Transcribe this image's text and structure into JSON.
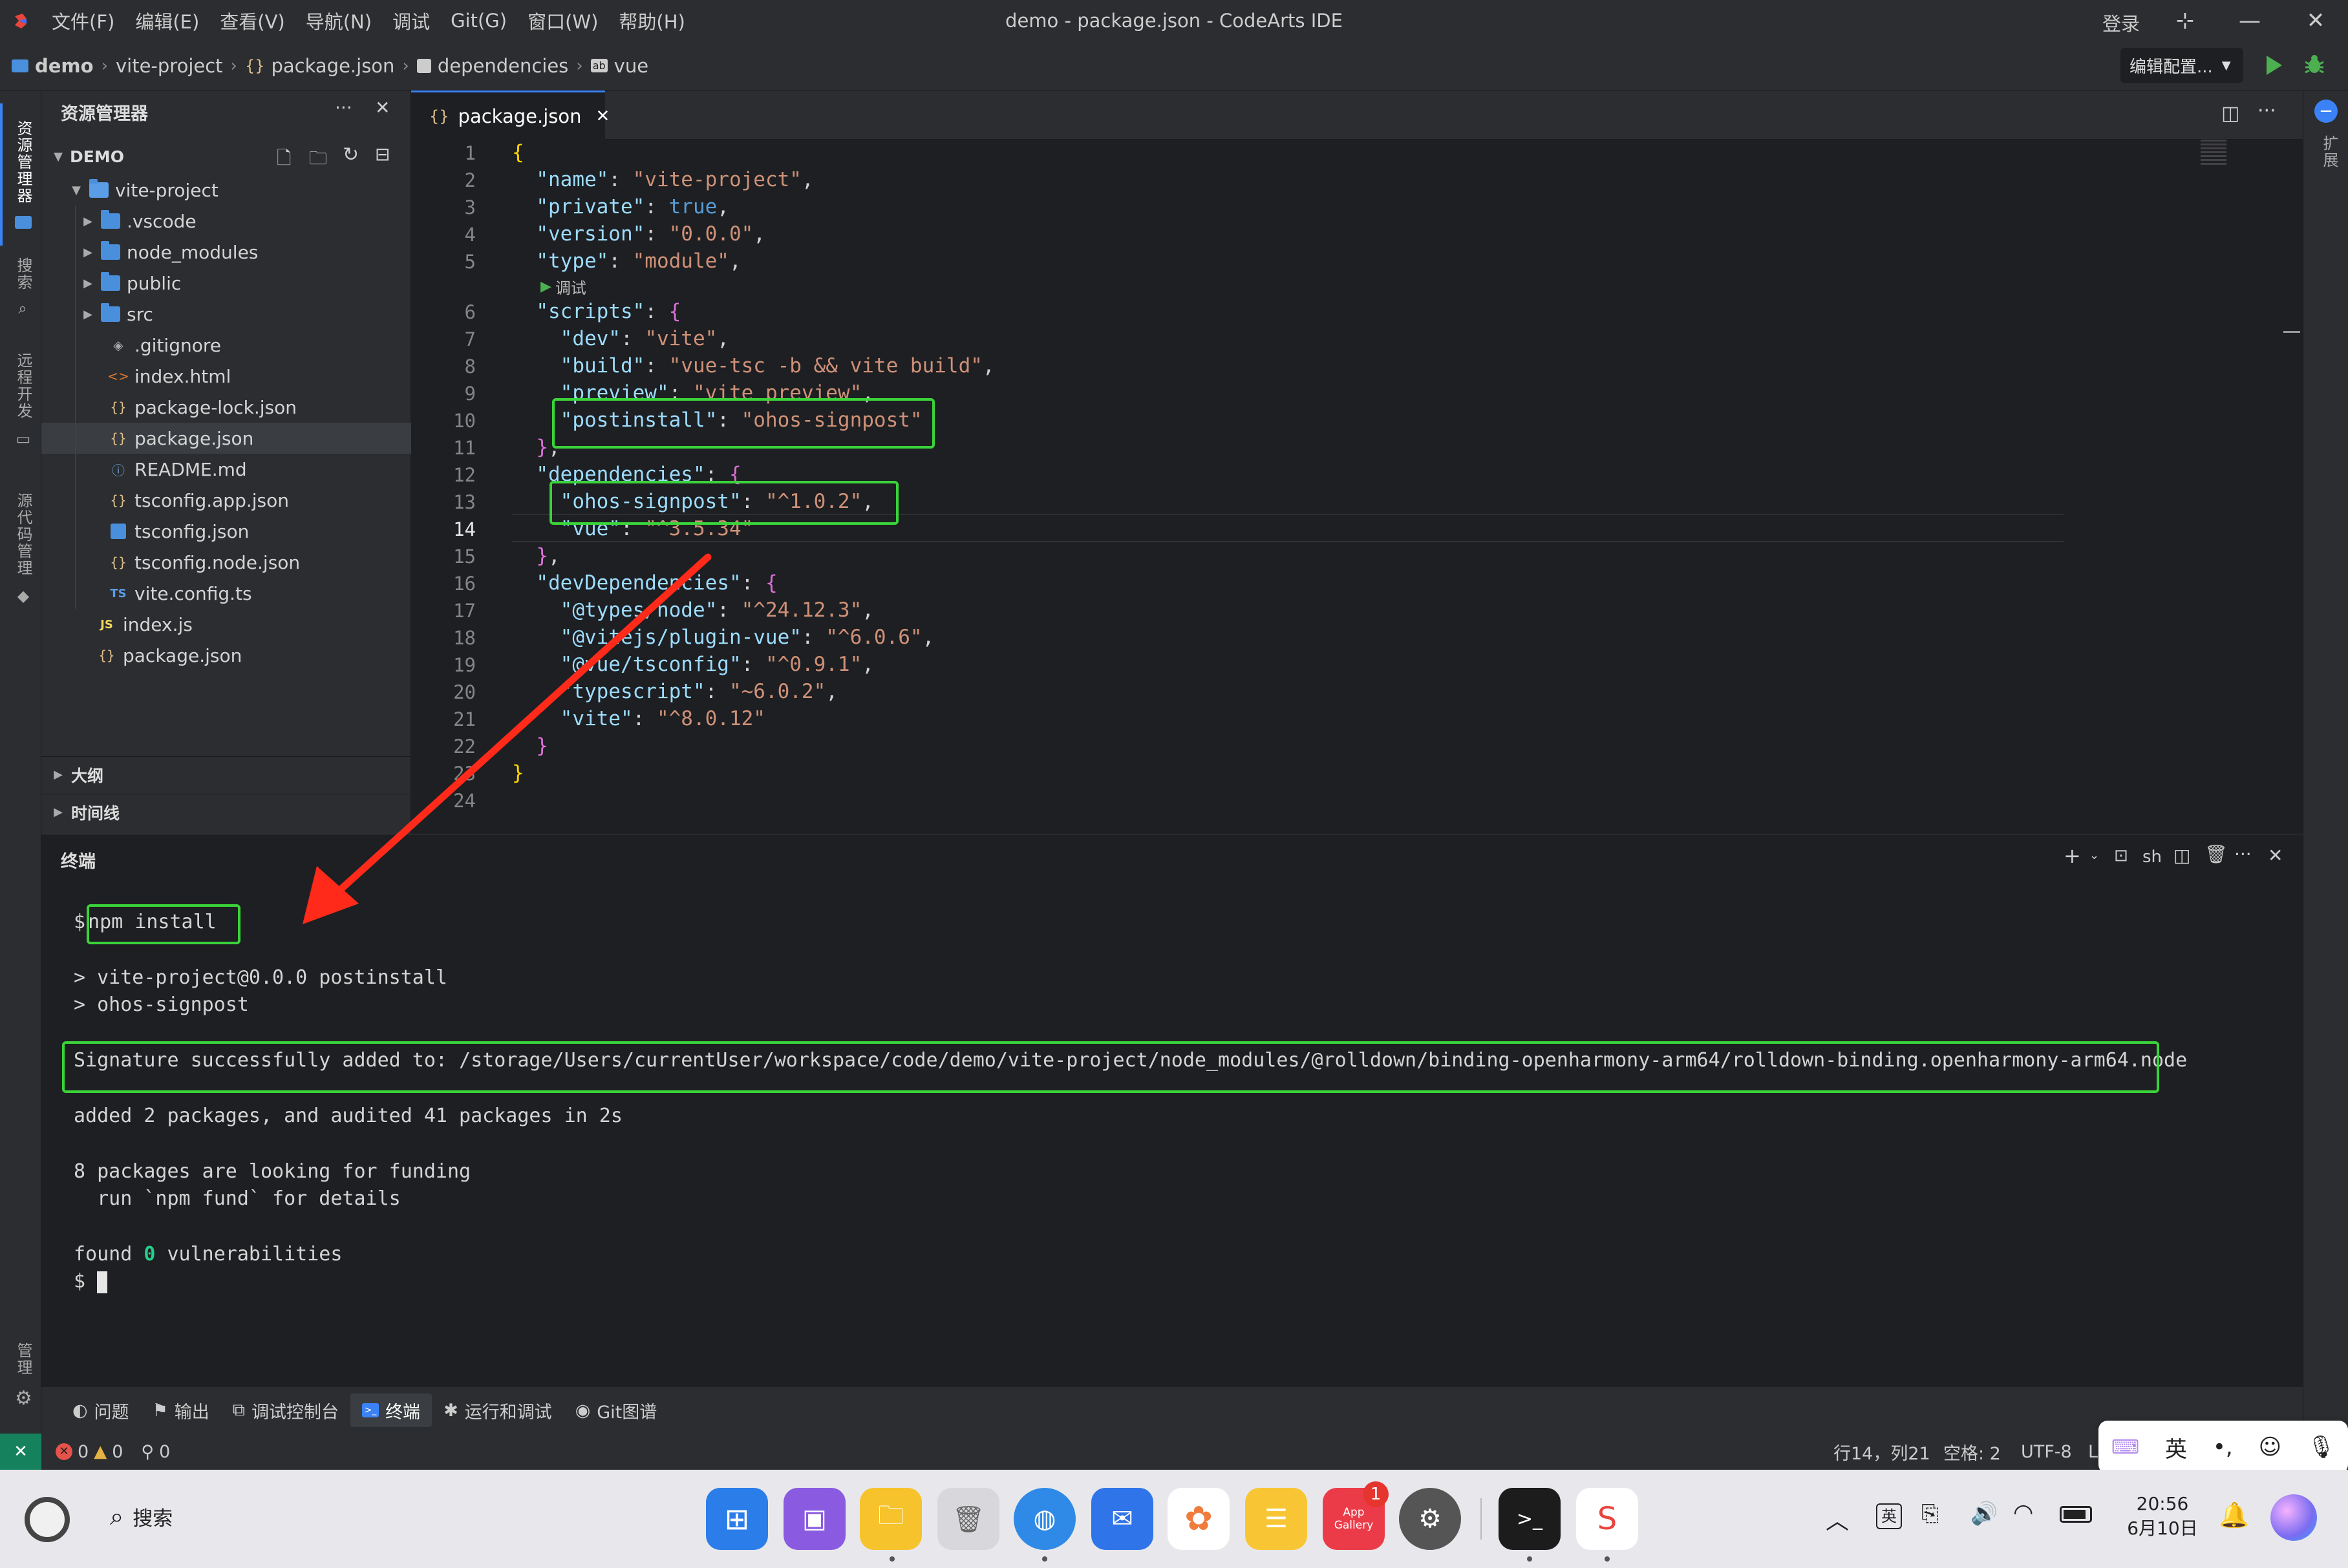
{
  "titlebar": {
    "menu": [
      "文件(F)",
      "编辑(E)",
      "查看(V)",
      "导航(N)",
      "调试",
      "Git(G)",
      "窗口(W)",
      "帮助(H)"
    ],
    "title": "demo - package.json - CodeArts IDE",
    "login": "登录"
  },
  "breadcrumb": {
    "items": [
      "demo",
      "vite-project",
      "package.json",
      "dependencies",
      "vue"
    ],
    "run_config": "编辑配置..."
  },
  "activitybar": {
    "explorer": "资源管理器",
    "search": "搜索",
    "remote": "远程开发",
    "scm": "源代码管理",
    "manage": "管理",
    "extensions": "扩展"
  },
  "sidebar": {
    "title": "资源管理器",
    "root": "DEMO",
    "tree": [
      {
        "name": "vite-project",
        "type": "folder-open"
      },
      {
        "name": ".vscode",
        "type": "folder"
      },
      {
        "name": "node_modules",
        "type": "folder"
      },
      {
        "name": "public",
        "type": "folder"
      },
      {
        "name": "src",
        "type": "folder"
      },
      {
        "name": ".gitignore",
        "type": "git"
      },
      {
        "name": "index.html",
        "type": "html"
      },
      {
        "name": "package-lock.json",
        "type": "json"
      },
      {
        "name": "package.json",
        "type": "json"
      },
      {
        "name": "README.md",
        "type": "info"
      },
      {
        "name": "tsconfig.app.json",
        "type": "json"
      },
      {
        "name": "tsconfig.json",
        "type": "ts-json"
      },
      {
        "name": "tsconfig.node.json",
        "type": "json"
      },
      {
        "name": "vite.config.ts",
        "type": "ts"
      },
      {
        "name": "index.js",
        "type": "js"
      },
      {
        "name": "package.json",
        "type": "json"
      }
    ],
    "outline": "大纲",
    "timeline": "时间线"
  },
  "editor": {
    "tab": "package.json",
    "codelens": "调试",
    "line_numbers": [
      "1",
      "2",
      "3",
      "4",
      "5",
      "6",
      "7",
      "8",
      "9",
      "10",
      "11",
      "12",
      "13",
      "14",
      "15",
      "16",
      "17",
      "18",
      "19",
      "20",
      "21",
      "22",
      "23",
      "24"
    ],
    "lines": {
      "l1": "{",
      "l2k": "\"name\"",
      "l2v": "\"vite-project\"",
      "l3k": "\"private\"",
      "l3v": "true",
      "l4k": "\"version\"",
      "l4v": "\"0.0.0\"",
      "l5k": "\"type\"",
      "l5v": "\"module\"",
      "l6k": "\"scripts\"",
      "l7k": "\"dev\"",
      "l7v": "\"vite\"",
      "l8k": "\"build\"",
      "l8v": "\"vue-tsc -b && vite build\"",
      "l9k": "\"preview\"",
      "l9v": "\"vite preview\"",
      "l10k": "\"postinstall\"",
      "l10v": "\"ohos-signpost\"",
      "l12k": "\"dependencies\"",
      "l13k": "\"ohos-signpost\"",
      "l13v": "\"^1.0.2\"",
      "l14k": "\"vue\"",
      "l14v": "\"^3.5.34\"",
      "l16k": "\"devDependencies\"",
      "l17k": "\"@types/node\"",
      "l17v": "\"^24.12.3\"",
      "l18k": "\"@vitejs/plugin-vue\"",
      "l18v": "\"^6.0.6\"",
      "l19k": "\"@vue/tsconfig\"",
      "l19v": "\"^0.9.1\"",
      "l20k": "\"typescript\"",
      "l20v": "\"~6.0.2\"",
      "l21k": "\"vite\"",
      "l21v": "\"^8.0.12\""
    }
  },
  "panel": {
    "title": "终端",
    "shell": "sh",
    "prompt": "$",
    "command": "npm install",
    "out1": "> vite-project@0.0.0 postinstall",
    "out2": "> ohos-signpost",
    "signature": "Signature successfully added to: /storage/Users/currentUser/workspace/code/demo/vite-project/node_modules/@rolldown/binding-openharmony-arm64/rolldown-binding.openharmony-arm64.node",
    "added": "added 2 packages, and audited 41 packages in 2s",
    "funding1": "8 packages are looking for funding",
    "funding2": "  run `npm fund` for details",
    "found_prefix": "found ",
    "found_count": "0",
    "found_suffix": " vulnerabilities",
    "prompt2": "$"
  },
  "tooltabs": [
    "问题",
    "输出",
    "调试控制台",
    "终端",
    "运行和调试",
    "Git图谱"
  ],
  "statusbar": {
    "errors": "0",
    "warnings": "0",
    "ports": "0",
    "position": "行14，列21",
    "indent": "空格: 2",
    "encoding": "UTF-8",
    "eol": "L"
  },
  "ime": {
    "lang": "英"
  },
  "taskbar": {
    "search": "搜索",
    "badge": "1",
    "appgallery": "App Gallery",
    "time": "20:56",
    "date": "6月10日",
    "ime_indicator": "英"
  },
  "colors": {
    "highlight": "#3ad33a",
    "arrow": "#ff2a1a",
    "accent": "#3b82f6"
  }
}
